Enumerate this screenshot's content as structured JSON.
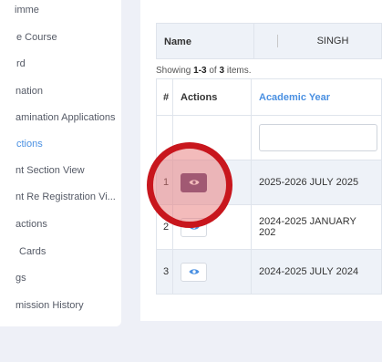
{
  "sidebar": {
    "items": [
      {
        "label": "imme"
      },
      {
        "label": "e Course"
      },
      {
        "label": "rd"
      },
      {
        "label": "nation"
      },
      {
        "label": "amination Applications"
      },
      {
        "label": "ctions",
        "active": true
      },
      {
        "label": "nt Section View"
      },
      {
        "label": "nt Re Registration Vi..."
      },
      {
        "label": "actions"
      },
      {
        "label": "Cards"
      },
      {
        "label": "gs"
      },
      {
        "label": "mission History"
      }
    ]
  },
  "student": {
    "name_label": "Name",
    "name_value": "SINGH"
  },
  "summary": {
    "prefix": "Showing ",
    "range": "1-3",
    "of": " of ",
    "count": "3",
    "suffix": " items."
  },
  "table": {
    "headers": [
      "#",
      "Actions",
      "Academic Year"
    ],
    "filter_value": "",
    "rows": [
      {
        "num": "1",
        "academic_year": "2025-2026 JULY 2025",
        "action_icon": "eye-icon",
        "highlighted": true
      },
      {
        "num": "2",
        "academic_year": "2024-2025 JANUARY 202",
        "action_icon": "eye-icon",
        "highlighted": false
      },
      {
        "num": "3",
        "academic_year": "2024-2025 JULY 2024",
        "action_icon": "eye-icon",
        "highlighted": false
      }
    ]
  },
  "colors": {
    "accent": "#4a90e2",
    "highlight_button": "#5b3a6e",
    "annotation_circle": "#c8161d"
  }
}
